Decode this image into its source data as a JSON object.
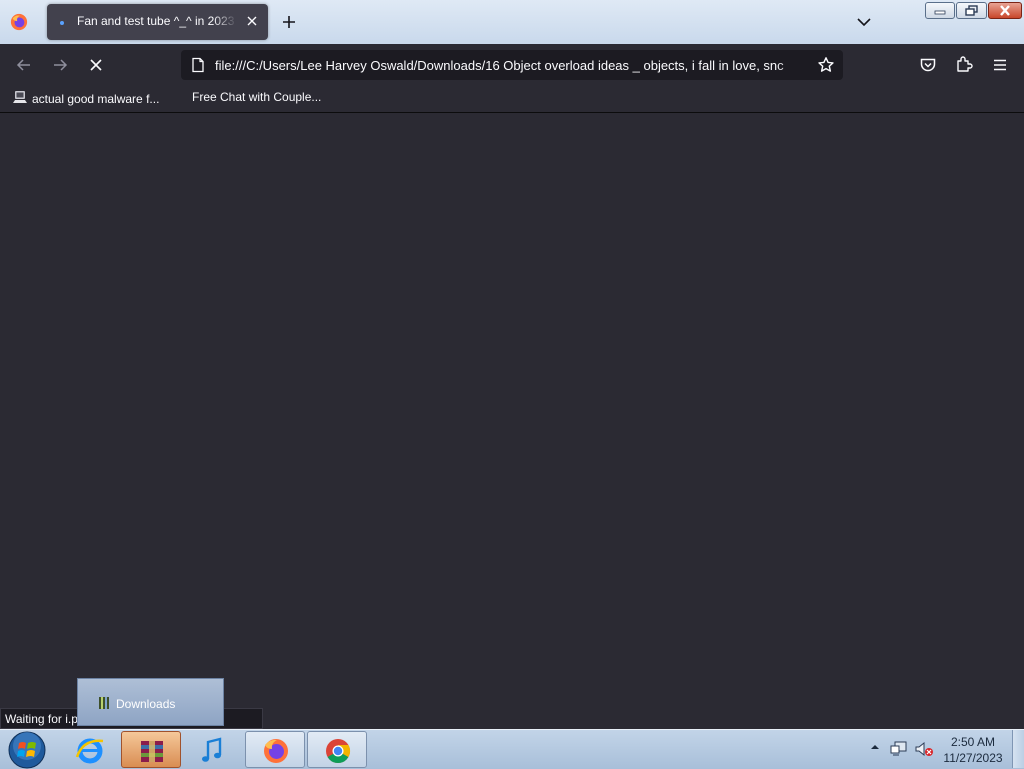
{
  "browser": {
    "tab": {
      "title": "Fan and test tube ^_^ in 2023 | "
    },
    "url": "file:///C:/Users/Lee Harvey Oswald/Downloads/16 Object overload ideas _ objects, i fall in love, snc",
    "bookmarks": [
      {
        "label": "actual good malware f...",
        "icon": "bookmark-computer-icon"
      },
      {
        "label": "Free Chat with Couple..."
      }
    ],
    "status_text": "Waiting for i.p"
  },
  "jumplist": {
    "item": "Downloads"
  },
  "taskbar": {
    "time": "2:50 AM",
    "date": "11/27/2023",
    "apps": [
      "internet-explorer-icon",
      "winrar-icon",
      "itunes-icon",
      "firefox-icon",
      "chrome-icon"
    ]
  },
  "colors": {
    "content_bg": "#2b2a33",
    "toolbar_bg": "#2b2a33",
    "urlbar_bg": "#1c1b22",
    "tab_bg": "#42414d",
    "taskbar_bg": "#b4c8e0"
  }
}
